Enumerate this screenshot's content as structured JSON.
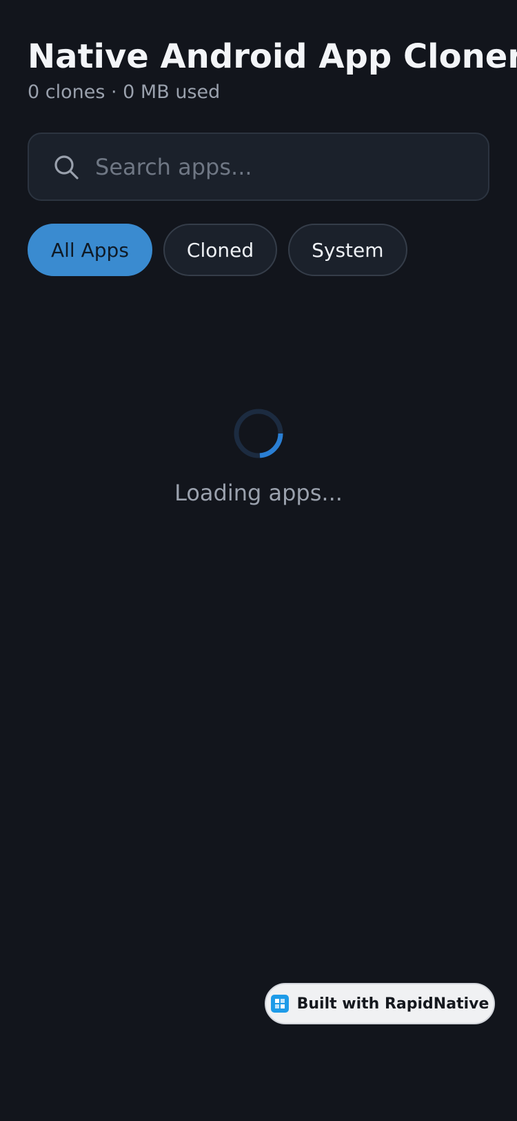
{
  "header": {
    "title": "Native Android App Cloner / D",
    "subtitle": "0 clones · 0 MB used"
  },
  "search": {
    "placeholder": "Search apps...",
    "value": ""
  },
  "filters": [
    {
      "label": "All Apps",
      "active": true
    },
    {
      "label": "Cloned",
      "active": false
    },
    {
      "label": "System",
      "active": false
    }
  ],
  "loading": {
    "text": "Loading apps..."
  },
  "badge": {
    "label": "Built with RapidNative"
  },
  "colors": {
    "background": "#12151c",
    "accent": "#3a8bd0",
    "spinner": "#2a7fd4"
  },
  "icons": {
    "search": "search-icon",
    "spinner": "spinner-icon",
    "badge": "rapidnative-logo-icon"
  }
}
